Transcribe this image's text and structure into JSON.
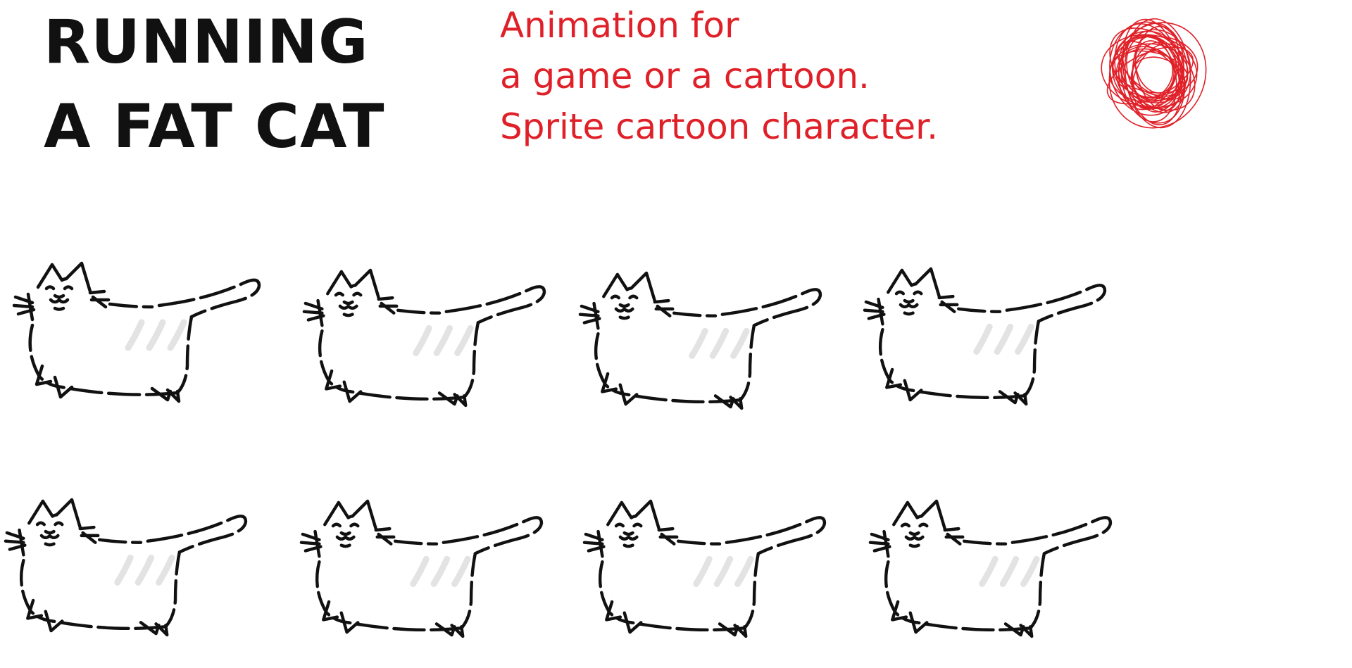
{
  "header": {
    "title_line1": "RUNNING",
    "title_line2": "A FAT CAT",
    "subtitle_line1": "Animation for",
    "subtitle_line2": "a game or a cartoon.",
    "subtitle_line3": "Sprite cartoon character."
  },
  "colors": {
    "title": "#111111",
    "accent": "#e02028",
    "stroke": "#111111",
    "stripes": "#e3e3e3"
  },
  "decoration": {
    "yarn_ball_icon": "yarn-ball-icon"
  },
  "sprite_sheet": {
    "frame_count": 8
  }
}
